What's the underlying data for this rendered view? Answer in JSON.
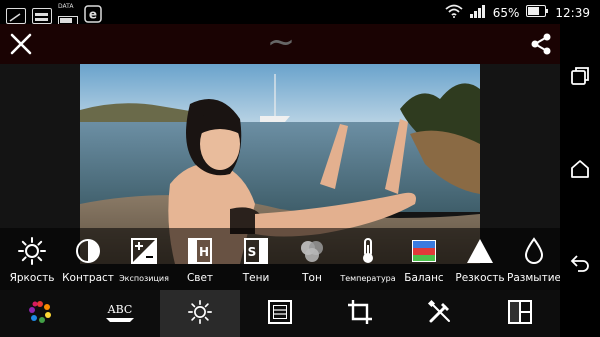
{
  "status": {
    "data_label": "DATA",
    "battery": "65%",
    "time": "12:39"
  },
  "title": {
    "symbol": "~"
  },
  "tools": [
    {
      "label": "Яркость",
      "icon": "brightness-icon"
    },
    {
      "label": "Контраст",
      "icon": "contrast-icon"
    },
    {
      "label": "Экспозиция",
      "icon": "exposure-icon"
    },
    {
      "label": "Свет",
      "icon": "highlights-icon"
    },
    {
      "label": "Тени",
      "icon": "shadows-icon"
    },
    {
      "label": "Тон",
      "icon": "tone-icon"
    },
    {
      "label": "Температура",
      "icon": "temperature-icon"
    },
    {
      "label": "Баланс",
      "icon": "balance-icon"
    },
    {
      "label": "Резкость",
      "icon": "sharpness-icon"
    },
    {
      "label": "Размытие",
      "icon": "blur-icon"
    }
  ],
  "bottom": {
    "items": [
      "palette-icon",
      "text-abc-icon",
      "brightness-icon",
      "frame-icon",
      "crop-icon",
      "tools-icon",
      "layout-icon"
    ],
    "abc_label": "ABC",
    "active_index": 2
  },
  "colors": {
    "titlebar": "#1a0303",
    "balance_top": "#3a7be0",
    "balance_mid": "#e03a3a",
    "balance_bot": "#4cc04c"
  }
}
